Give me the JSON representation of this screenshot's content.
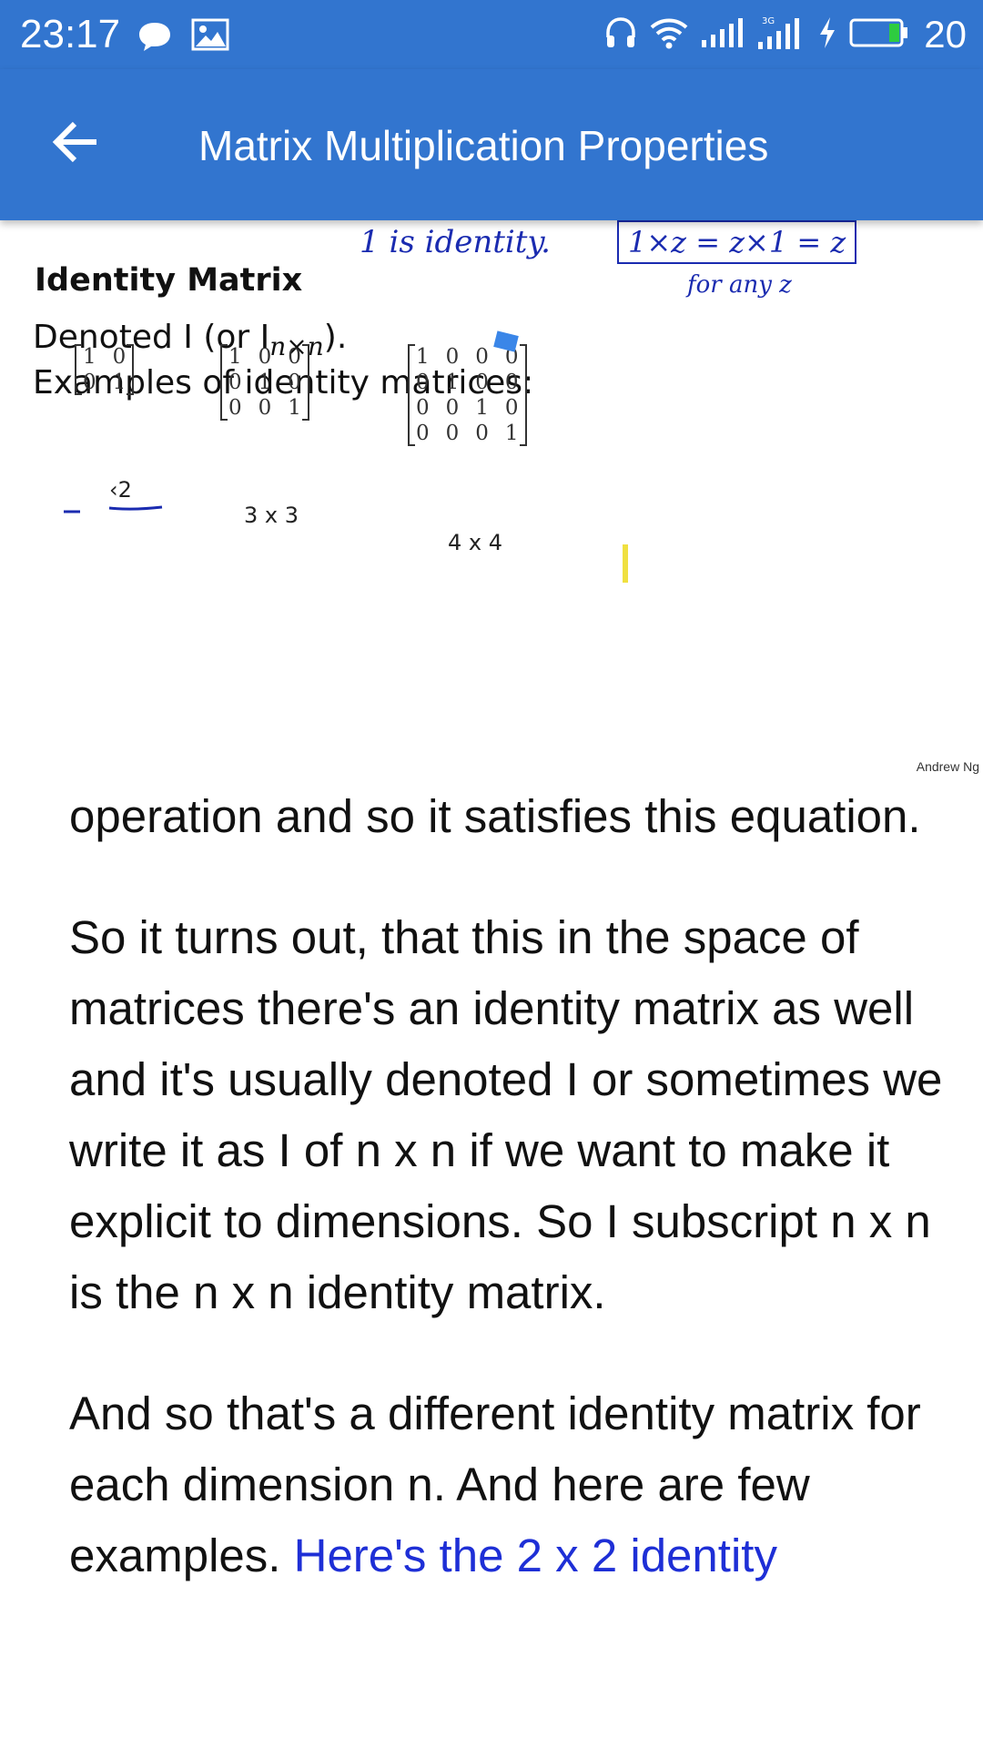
{
  "status_bar": {
    "time": "23:17",
    "battery_text": "20",
    "icons": [
      "chat-bubble-icon",
      "image-icon",
      "headphones-icon",
      "wifi-icon",
      "signal-icon",
      "signal-3g-icon",
      "charging-icon",
      "battery-icon"
    ]
  },
  "app_bar": {
    "back_icon": "arrow-back-icon",
    "title": "Matrix Multiplication Properties"
  },
  "slide": {
    "heading": "Identity Matrix",
    "line1": "Denoted I (or I",
    "line1_sub": "n×n",
    "line1_end": ").",
    "line2": "Examples of identity matrices:",
    "annotation_identity": "1  is identity.",
    "annotation_box": "1×z = z×1 = z",
    "annotation_for_any": "for   any   z",
    "matrix_2x2": [
      [
        "1",
        "0"
      ],
      [
        "0",
        "1"
      ]
    ],
    "matrix_3x3": [
      [
        "1",
        "0",
        "0"
      ],
      [
        "0",
        "1",
        "0"
      ],
      [
        "0",
        "0",
        "1"
      ]
    ],
    "matrix_4x4": [
      [
        "1",
        "0",
        "0",
        "0"
      ],
      [
        "0",
        "1",
        "0",
        "0"
      ],
      [
        "0",
        "0",
        "1",
        "0"
      ],
      [
        "0",
        "0",
        "0",
        "1"
      ]
    ],
    "label_2x2": "‹2",
    "label_3x3": "3 x 3",
    "label_4x4": "4 x 4",
    "credit": "Andrew Ng"
  },
  "transcript": {
    "p1": "operation and so it satisfies this equation.",
    "p2": "So it turns out, that this in the space of matrices there's an identity matrix as well and it's usually denoted I or sometimes we write it as I of n x n if we want to make it explicit to dimensions. So I subscript n x n is the n x n identity matrix.",
    "p3_plain": "And so that's a different identity matrix for each dimension n. And here are few examples. ",
    "p3_link": "Here's the 2 x 2 identity"
  },
  "colors": {
    "primary": "#3275cf",
    "link": "#1e2fd6",
    "ink": "#1a2bb0"
  }
}
